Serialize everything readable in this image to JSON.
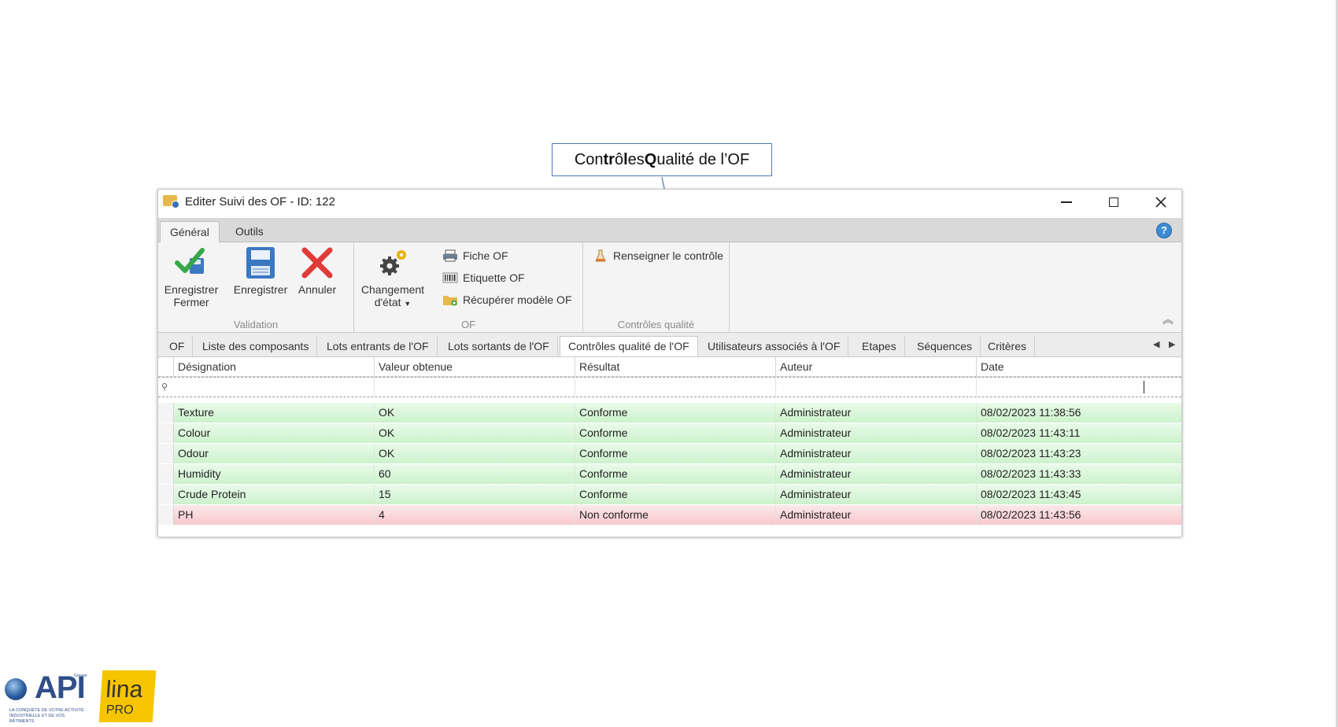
{
  "callout": {
    "pre": "Con",
    "b1": "tr",
    "mid1": "ô",
    "b2": "l",
    "mid2": "es ",
    "b3": "Q",
    "rest": "ualité de l’OF"
  },
  "window": {
    "title": "Editer Suivi des OF - ID: 122"
  },
  "ribbon_tabs": [
    {
      "label": "Général",
      "active": true
    },
    {
      "label": "Outils",
      "active": false
    }
  ],
  "help_icon": "?",
  "ribbon": {
    "validation": {
      "label": "Validation",
      "buttons": [
        {
          "label1": "Enregistrer",
          "label2": "Fermer"
        },
        {
          "label1": "Enregistrer"
        },
        {
          "label1": "Annuler"
        }
      ]
    },
    "of": {
      "label": "OF",
      "change_state": {
        "label1": "Changement",
        "label2": "d'état"
      },
      "small": [
        "Fiche OF",
        "Etiquette OF",
        "Récupérer modèle OF"
      ]
    },
    "qc": {
      "label": "Contrôles qualité",
      "button": "Renseigner le contrôle"
    }
  },
  "subtabs": [
    {
      "label": "OF"
    },
    {
      "label": "Liste des composants"
    },
    {
      "label": "Lots entrants de l'OF"
    },
    {
      "label": "Lots sortants de l'OF"
    },
    {
      "label": "Contrôles qualité de l'OF",
      "active": true
    },
    {
      "label": "Utilisateurs associés à l'OF"
    },
    {
      "label": "Etapes"
    },
    {
      "label": "Séquences"
    },
    {
      "label": "Critères"
    }
  ],
  "grid": {
    "columns": [
      "Désignation",
      "Valeur obtenue",
      "Résultat",
      "Auteur",
      "Date"
    ],
    "rows": [
      {
        "designation": "Texture",
        "valeur": "OK",
        "resultat": "Conforme",
        "auteur": "Administrateur",
        "date": "08/02/2023 11:38:56",
        "status": "ok"
      },
      {
        "designation": "Colour",
        "valeur": "OK",
        "resultat": "Conforme",
        "auteur": "Administrateur",
        "date": "08/02/2023 11:43:11",
        "status": "ok"
      },
      {
        "designation": "Odour",
        "valeur": "OK",
        "resultat": "Conforme",
        "auteur": "Administrateur",
        "date": "08/02/2023 11:43:23",
        "status": "ok"
      },
      {
        "designation": "Humidity",
        "valeur": "60",
        "resultat": "Conforme",
        "auteur": "Administrateur",
        "date": "08/02/2023 11:43:33",
        "status": "ok"
      },
      {
        "designation": "Crude Protein",
        "valeur": "15",
        "resultat": "Conforme",
        "auteur": "Administrateur",
        "date": "08/02/2023 11:43:45",
        "status": "ok"
      },
      {
        "designation": "PH",
        "valeur": "4",
        "resultat": "Non conforme",
        "auteur": "Administrateur",
        "date": "08/02/2023 11:43:56",
        "status": "nok"
      }
    ]
  },
  "logos": {
    "api": {
      "text": "API",
      "groupe": "Groupe",
      "sub": "LA CONQUÊTE DE VOTRE ACTIVITÉ INDUSTRIELLE ET DE VOS BÂTIMENTS"
    },
    "lina": {
      "text": "lina",
      "pro": "PRO"
    }
  },
  "colors": {
    "accent": "#4f79b8",
    "ok_row": "#ccf2cc",
    "nok_row": "#f8c8cd",
    "logo_yellow": "#f7c500",
    "api_blue": "#2f4f8a"
  }
}
